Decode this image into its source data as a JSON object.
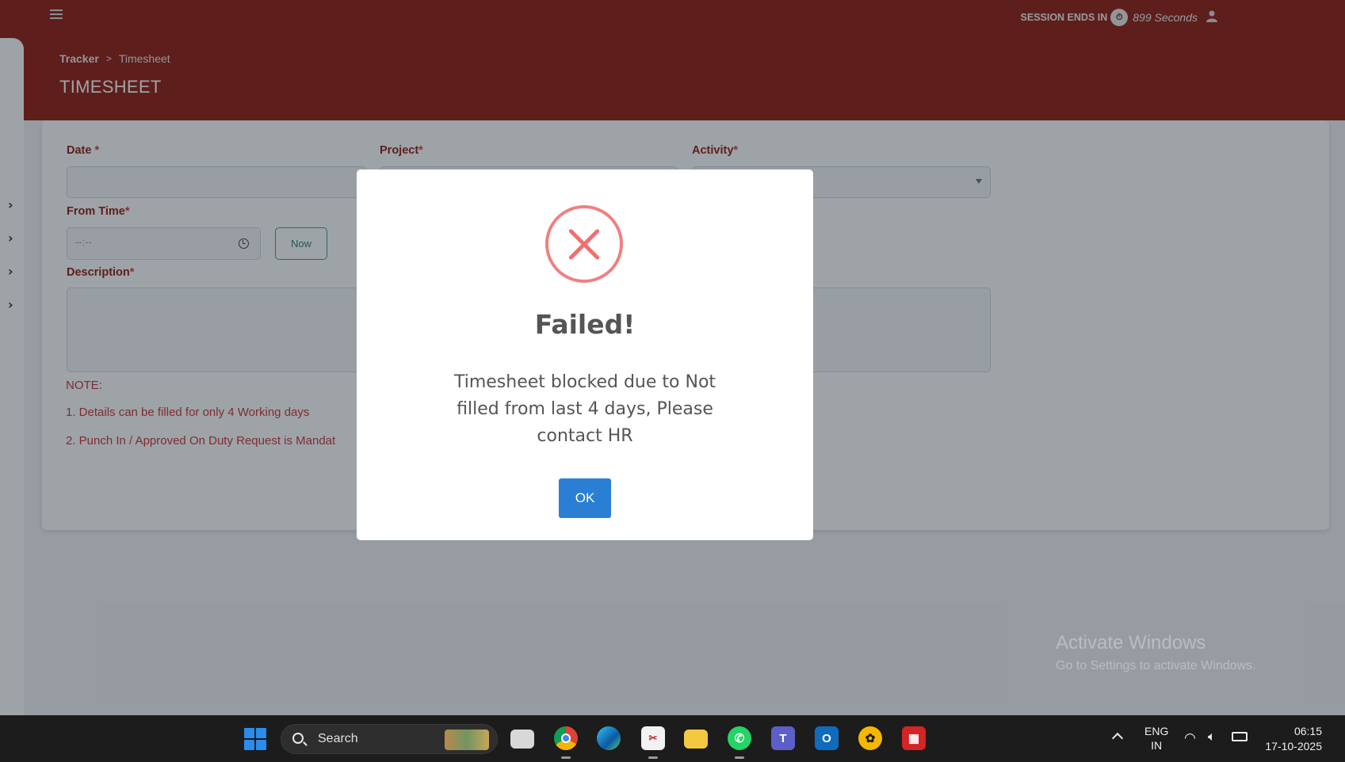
{
  "header": {
    "session_label": "SESSION ENDS IN",
    "session_seconds": "899 Seconds",
    "timer_icon": "timer-icon",
    "user_icon": "user-icon"
  },
  "breadcrumb": {
    "root": "Tracker",
    "separator": ">",
    "current": "Timesheet"
  },
  "page_title": "TIMESHEET",
  "form": {
    "date_label": "Date",
    "date_value": "",
    "project_label": "Project",
    "activity_label": "Activity",
    "from_time_label": "From Time",
    "from_time_placeholder": "--:--",
    "now_button": "Now",
    "description_label": "Description",
    "required_marker": "*",
    "note_title": "NOTE:",
    "note_1": "1. Details can be filled for only 4 Working days",
    "note_2": "2. Punch In / Approved On Duty Request is Mandat"
  },
  "modal": {
    "icon": "error-x-icon",
    "title": "Failed!",
    "message": "Timesheet blocked due to Not filled from last 4 days, Please contact HR",
    "ok_button": "OK"
  },
  "watermark": {
    "line1": "Activate Windows",
    "line2": "Go to Settings to activate Windows."
  },
  "taskbar": {
    "search_placeholder": "Search",
    "language": "ENG",
    "region": "IN",
    "time": "06:15",
    "date": "17-10-2025"
  },
  "colors": {
    "header_bg": "#8b0e02",
    "label_color": "#8b0e02",
    "note_color": "#c62828",
    "ok_button": "#2a7fd4",
    "error_icon": "#f08080",
    "now_button_border": "#2a9a8a"
  }
}
